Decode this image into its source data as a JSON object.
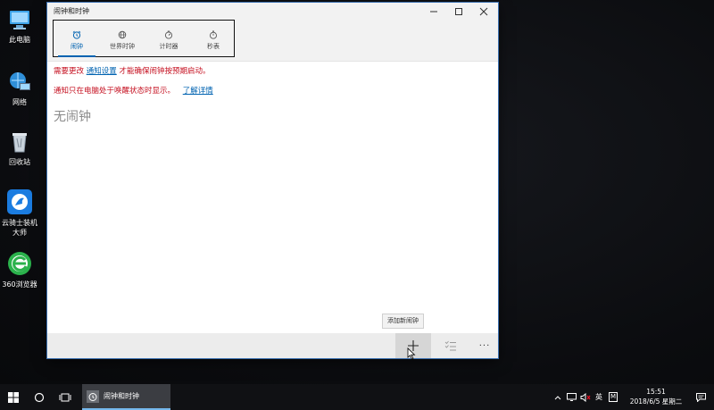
{
  "desktop": {
    "icons": [
      {
        "label": "此电脑"
      },
      {
        "label": "网络"
      },
      {
        "label": "回收站"
      },
      {
        "label": "云骑士装机\n大师"
      },
      {
        "label": "360浏览器"
      }
    ]
  },
  "window": {
    "title": "闹钟和时钟",
    "tabs": [
      {
        "label": "闹钟",
        "icon": "alarm-icon"
      },
      {
        "label": "世界时钟",
        "icon": "globe-icon"
      },
      {
        "label": "计时器",
        "icon": "timer-icon"
      },
      {
        "label": "秒表",
        "icon": "stopwatch-icon"
      }
    ],
    "notice1": {
      "prefix": "需要更改",
      "link": "通知设置",
      "suffix": "才能确保闹钟按预期启动。"
    },
    "notice2": {
      "prefix": "通知只在电脑处于唤醒状态时显示。",
      "link": "了解详情"
    },
    "empty_text": "无闹钟",
    "tooltip": "添加新闹钟",
    "commands": {
      "add": "add-icon",
      "select": "select-icon",
      "more": "···"
    }
  },
  "taskbar": {
    "app_label": "闹钟和时钟",
    "ime": "英",
    "ime2": "M",
    "time": "15:51",
    "date": "2018/6/5 星期二"
  },
  "colors": {
    "accent": "#0063b1",
    "warning": "#c50f1f"
  }
}
